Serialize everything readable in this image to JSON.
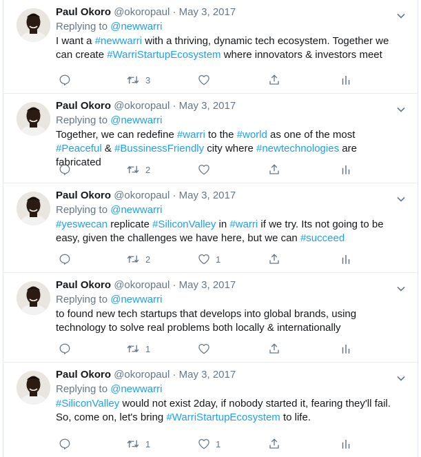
{
  "tweets": [
    {
      "name": "Paul Okoro",
      "handle": "@okoropaul",
      "sep": " · ",
      "date": "May 3, 2017",
      "replying_prefix": "Replying to ",
      "replying_to": "@newwarri",
      "text": [
        {
          "t": "I want a "
        },
        {
          "t": "#newwarri",
          "link": true
        },
        {
          "t": " with a thriving, dynamic tech ecosystem. Together we can create "
        },
        {
          "t": "#WarriStartupEcosystem",
          "link": true
        },
        {
          "t": " where innovators & investors meet"
        }
      ],
      "reply_count": "",
      "retweet_count": "3",
      "like_count": ""
    },
    {
      "name": "Paul Okoro",
      "handle": "@okoropaul",
      "sep": " · ",
      "date": "May 3, 2017",
      "replying_prefix": "Replying to ",
      "replying_to": "@newwarri",
      "text": [
        {
          "t": "Together, we can redefine "
        },
        {
          "t": "#warri",
          "link": true
        },
        {
          "t": " to the "
        },
        {
          "t": "#world",
          "link": true
        },
        {
          "t": " as one of the most "
        },
        {
          "t": "#Peaceful",
          "link": true
        },
        {
          "t": " & "
        },
        {
          "t": "#BussinessFriendly",
          "link": true
        },
        {
          "t": " city where "
        },
        {
          "t": "#newtechnologies",
          "link": true
        },
        {
          "t": " are fabricated"
        }
      ],
      "reply_count": "",
      "retweet_count": "2",
      "like_count": ""
    },
    {
      "name": "Paul Okoro",
      "handle": "@okoropaul",
      "sep": " · ",
      "date": "May 3, 2017",
      "replying_prefix": "Replying to ",
      "replying_to": "@newwarri",
      "text": [
        {
          "t": "#yeswecan",
          "link": true
        },
        {
          "t": " replicate "
        },
        {
          "t": "#SiliconValley",
          "link": true
        },
        {
          "t": " in "
        },
        {
          "t": "#warri",
          "link": true
        },
        {
          "t": " if we try. Its not going to be easy, given the challenges we have here, but we can "
        },
        {
          "t": "#succeed",
          "link": true
        }
      ],
      "reply_count": "",
      "retweet_count": "2",
      "like_count": "1"
    },
    {
      "name": "Paul Okoro",
      "handle": "@okoropaul",
      "sep": " · ",
      "date": "May 3, 2017",
      "replying_prefix": "Replying to ",
      "replying_to": "@newwarri",
      "text": [
        {
          "t": "to found new tech startups that develops into global brands, using technology to solve real problems both locally & internationally"
        }
      ],
      "reply_count": "",
      "retweet_count": "1",
      "like_count": ""
    },
    {
      "name": "Paul Okoro",
      "handle": "@okoropaul",
      "sep": " · ",
      "date": "May 3, 2017",
      "replying_prefix": "Replying to ",
      "replying_to": "@newwarri",
      "text": [
        {
          "t": "#SiliconValley",
          "link": true
        },
        {
          "t": " would not exist 2day, if nobody started it, fearing they'll fail. So, come on, let's bring "
        },
        {
          "t": "#WarriStartupEcosystem",
          "link": true
        },
        {
          "t": " to life."
        }
      ],
      "reply_count": "",
      "retweet_count": "1",
      "like_count": "1"
    }
  ],
  "icons": {
    "reply": "reply-icon",
    "retweet": "retweet-icon",
    "like": "heart-icon",
    "share": "share-icon",
    "stats": "analytics-icon",
    "caret": "chevron-down-icon"
  },
  "colors": {
    "text": "#14171a",
    "muted": "#657786",
    "link": "#1da1f2",
    "border": "#e6ecf0"
  }
}
